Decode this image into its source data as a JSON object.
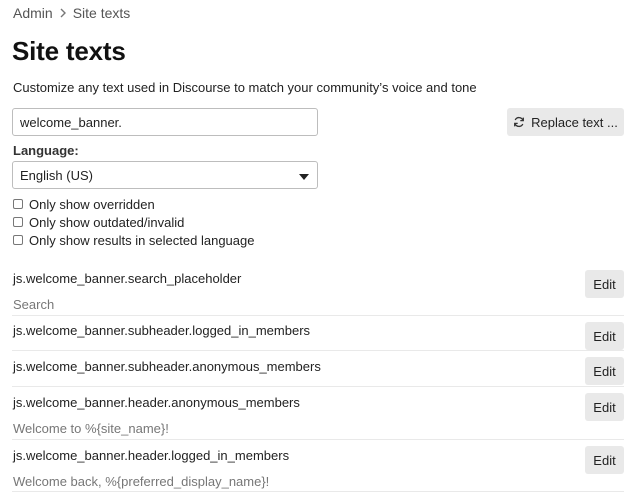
{
  "breadcrumb": {
    "root": "Admin",
    "current": "Site texts"
  },
  "page": {
    "title": "Site texts",
    "description": "Customize any text used in Discourse to match your community’s voice and tone"
  },
  "search": {
    "value": "welcome_banner."
  },
  "replace_button": {
    "label": "Replace text ..."
  },
  "language": {
    "label": "Language:",
    "selected": "English (US)"
  },
  "filters": [
    {
      "label": "Only show overridden",
      "checked": false
    },
    {
      "label": "Only show outdated/invalid",
      "checked": false
    },
    {
      "label": "Only show results in selected language",
      "checked": false
    }
  ],
  "edit_label": "Edit",
  "results": [
    {
      "key": "js.welcome_banner.search_placeholder",
      "value": "Search"
    },
    {
      "key": "js.welcome_banner.subheader.logged_in_members",
      "value": ""
    },
    {
      "key": "js.welcome_banner.subheader.anonymous_members",
      "value": ""
    },
    {
      "key": "js.welcome_banner.header.anonymous_members",
      "value": "Welcome to %{site_name}!"
    },
    {
      "key": "js.welcome_banner.header.logged_in_members",
      "value": "Welcome back, %{preferred_display_name}!"
    }
  ]
}
